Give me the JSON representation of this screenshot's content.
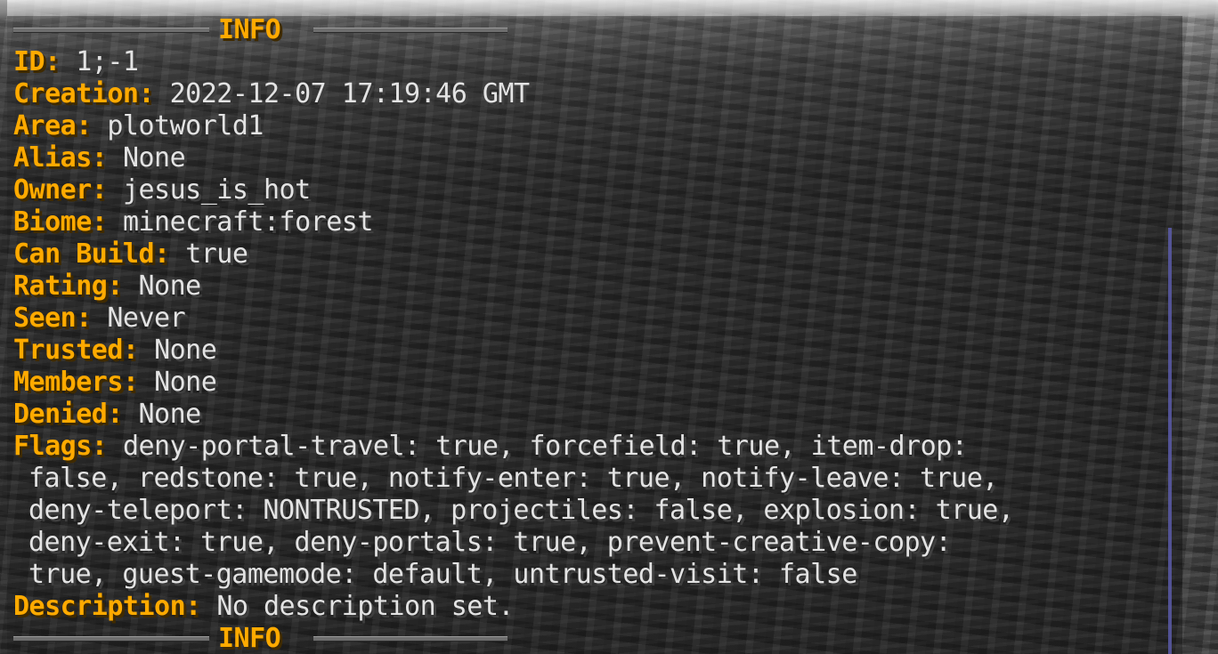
{
  "header": {
    "title": "INFO"
  },
  "footer": {
    "title": "INFO"
  },
  "fields": [
    {
      "key": "ID:",
      "value": "1;-1"
    },
    {
      "key": "Creation:",
      "value": "2022-12-07 17:19:46 GMT"
    },
    {
      "key": "Area:",
      "value": "plotworld1"
    },
    {
      "key": "Alias:",
      "value": "None"
    },
    {
      "key": "Owner:",
      "value": "jesus_is_hot"
    },
    {
      "key": "Biome:",
      "value": "minecraft:forest"
    },
    {
      "key": "Can Build:",
      "value": "true"
    },
    {
      "key": "Rating:",
      "value": "None"
    },
    {
      "key": "Seen:",
      "value": "Never"
    },
    {
      "key": "Trusted:",
      "value": "None"
    },
    {
      "key": "Members:",
      "value": "None"
    },
    {
      "key": "Denied:",
      "value": "None"
    }
  ],
  "flags": {
    "key": "Flags:",
    "lines": [
      "deny-portal-travel: true, forcefield: true, item-drop:",
      "false, redstone: true, notify-enter: true, notify-leave: true,",
      "deny-teleport: NONTRUSTED, projectiles: false, explosion: true,",
      "deny-exit: true, deny-portals: true, prevent-creative-copy:",
      "true, guest-gamemode: default, untrusted-visit: false"
    ]
  },
  "description": {
    "key": "Description:",
    "value": "No description set."
  },
  "colors": {
    "key_color": "#ffaa00",
    "value_color": "#e0e0e0",
    "scrollbar": "#5a5aa8"
  }
}
